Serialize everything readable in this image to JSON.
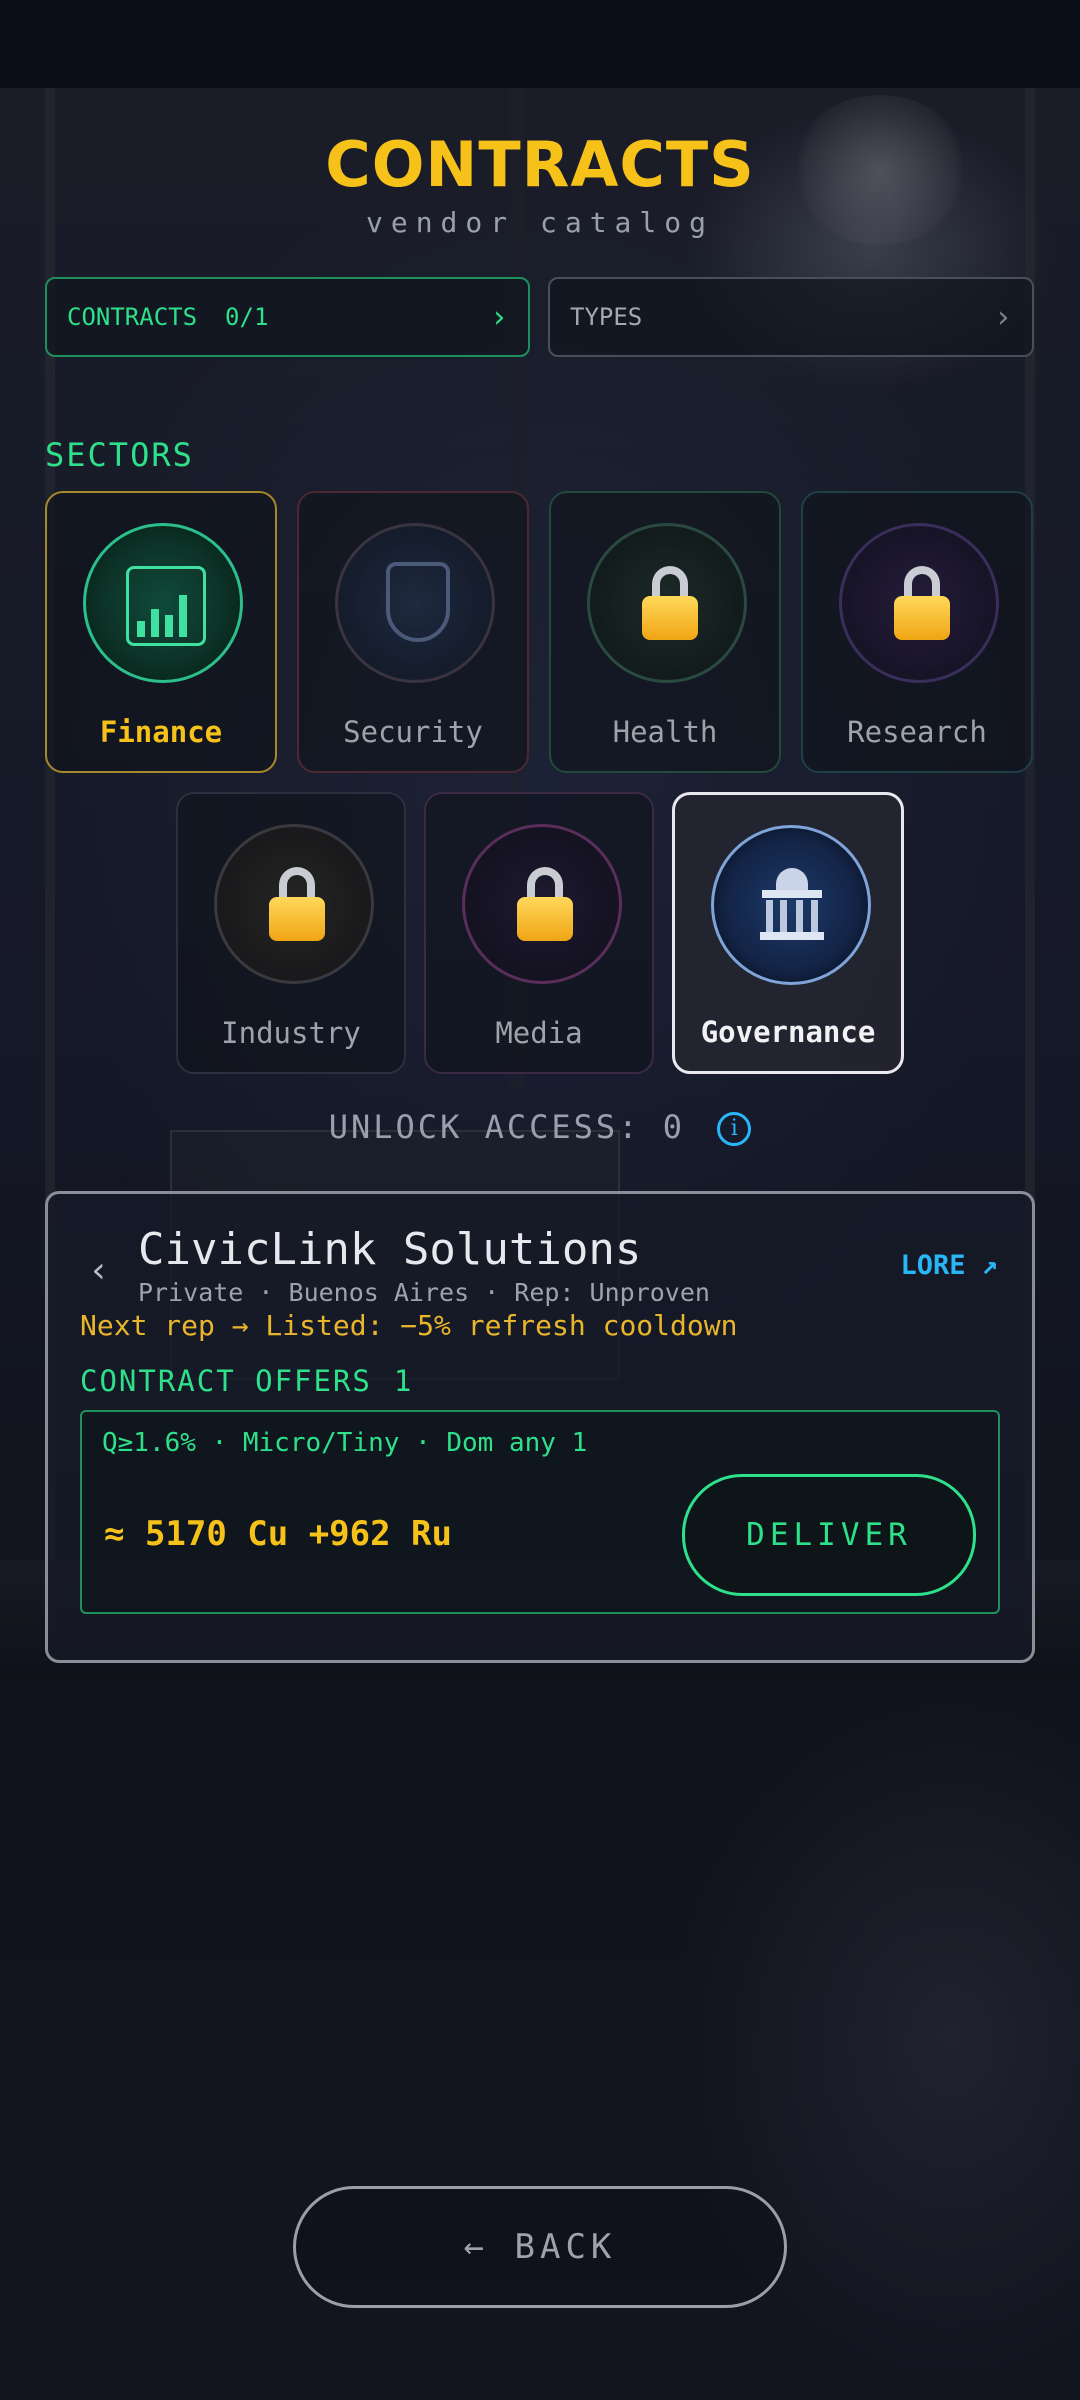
{
  "header": {
    "title": "CONTRACTS",
    "subtitle": "vendor catalog"
  },
  "filters": {
    "contracts": {
      "label": "CONTRACTS",
      "count": "0/1",
      "chevron": "›"
    },
    "types": {
      "label": "TYPES",
      "chevron": "›"
    }
  },
  "sectors_section": {
    "label": "SECTORS",
    "items": [
      {
        "name": "Finance",
        "icon": "finance-chip-chart-icon",
        "locked": false,
        "selected": false
      },
      {
        "name": "Security",
        "icon": "security-shield-icon",
        "locked": false,
        "selected": false
      },
      {
        "name": "Health",
        "icon": "health-dna-icon",
        "locked": true,
        "selected": false
      },
      {
        "name": "Research",
        "icon": "research-atom-icon",
        "locked": true,
        "selected": false
      },
      {
        "name": "Industry",
        "icon": "industry-gear-icon",
        "locked": true,
        "selected": false
      },
      {
        "name": "Media",
        "icon": "media-waveform-icon",
        "locked": true,
        "selected": false
      },
      {
        "name": "Governance",
        "icon": "governance-capitol-icon",
        "locked": false,
        "selected": true
      }
    ]
  },
  "unlock": {
    "text": "UNLOCK ACCESS: 0",
    "info_symbol": "i"
  },
  "vendor": {
    "prev_symbol": "‹",
    "name": "CivicLink Solutions",
    "meta": "Private · Buenos Aires · Rep: Unproven",
    "lore_label": "LORE ↗",
    "next_rep": "Next rep → Listed: −5% refresh cooldown",
    "offers_label": "CONTRACT OFFERS",
    "offers_count": "1",
    "offers": [
      {
        "terms": "Q≥1.6% · Micro/Tiny · Dom any 1",
        "reward": "≈ 5170 Cu +962 Ru",
        "deliver_label": "DELIVER"
      }
    ]
  },
  "footer": {
    "back_label": "← BACK"
  },
  "colors": {
    "accent_yellow": "#f6c21a",
    "accent_green": "#2ee08a",
    "accent_blue": "#29b6f6",
    "background": "#0b0d17"
  }
}
